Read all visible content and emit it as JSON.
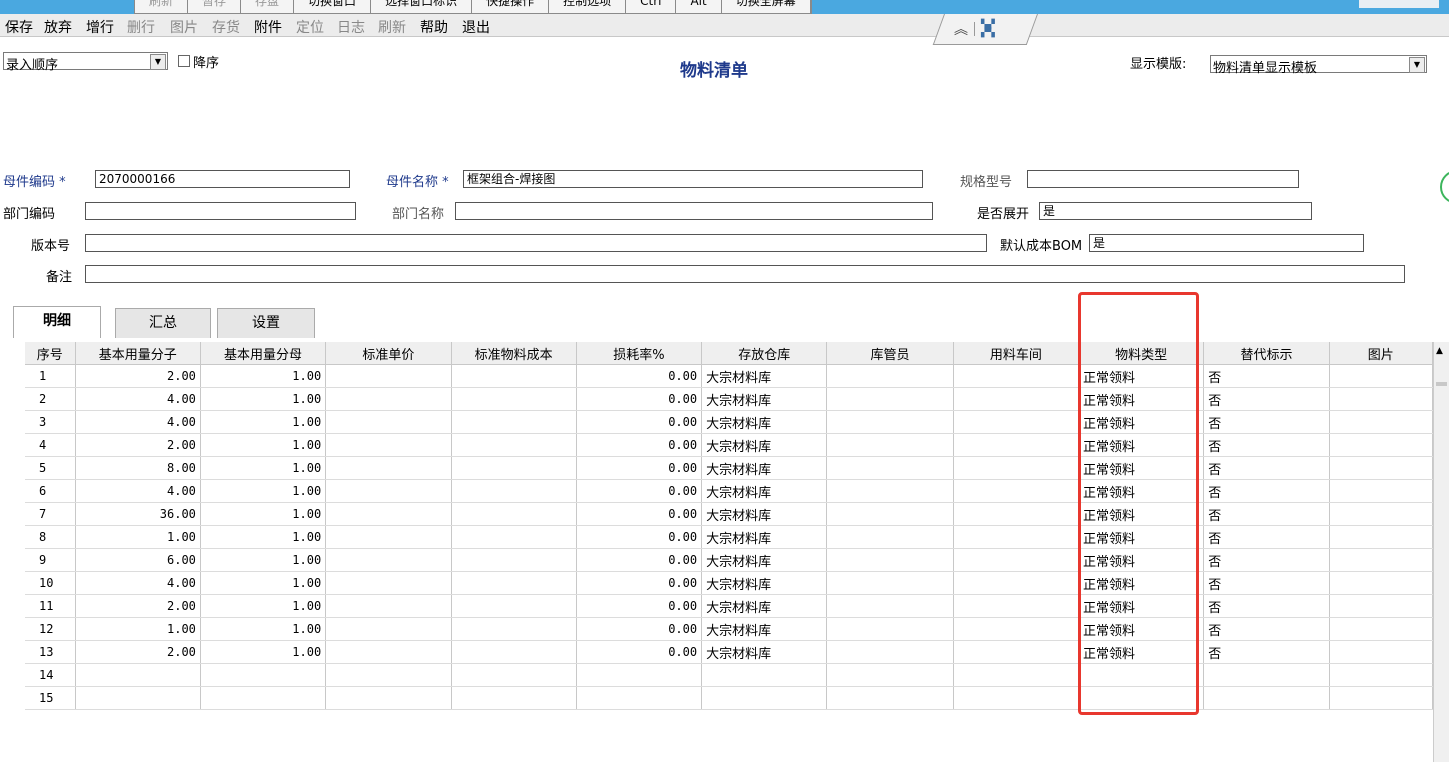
{
  "floating_toolbar": {
    "items": [
      "刷新",
      "暂存",
      "存盘",
      "切换窗口",
      "选择窗口标识",
      "快捷操作",
      "控制选项",
      "Ctrl",
      "Alt",
      "切换全屏幕"
    ]
  },
  "menu": {
    "items": [
      "保存",
      "放弃",
      "增行",
      "删行",
      "图片",
      "存货",
      "附件",
      "定位",
      "日志",
      "刷新",
      "帮助",
      "退出"
    ]
  },
  "header": {
    "sort_value": "录入顺序",
    "descending_label": "降序",
    "title": "物料清单",
    "template_label": "显示模版:",
    "template_value": "物料清单显示模板"
  },
  "form": {
    "parent_code_label": "母件编码",
    "parent_code_value": "2070000166",
    "parent_name_label": "母件名称",
    "parent_name_value": "框架组合-焊接图",
    "spec_label": "规格型号",
    "spec_value": "",
    "dept_code_label": "部门编码",
    "dept_code_value": "",
    "dept_name_label": "部门名称",
    "dept_name_value": "",
    "expand_label": "是否展开",
    "expand_value": "是",
    "version_label": "版本号",
    "version_value": "",
    "default_cost_label": "默认成本BOM",
    "default_cost_value": "是",
    "remark_label": "备注",
    "remark_value": ""
  },
  "tabs": [
    "明细",
    "汇总",
    "设置"
  ],
  "grid": {
    "columns": [
      "序号",
      "基本用量分子",
      "基本用量分母",
      "标准单价",
      "标准物料成本",
      "损耗率%",
      "存放仓库",
      "库管员",
      "用料车间",
      "物料类型",
      "替代标示",
      "图片"
    ],
    "rows": [
      {
        "no": "1",
        "num": "2.00",
        "den": "1.00",
        "loss": "0.00",
        "wh": "大宗材料库",
        "type": "正常领料",
        "alt": "否"
      },
      {
        "no": "2",
        "num": "4.00",
        "den": "1.00",
        "loss": "0.00",
        "wh": "大宗材料库",
        "type": "正常领料",
        "alt": "否"
      },
      {
        "no": "3",
        "num": "4.00",
        "den": "1.00",
        "loss": "0.00",
        "wh": "大宗材料库",
        "type": "正常领料",
        "alt": "否"
      },
      {
        "no": "4",
        "num": "2.00",
        "den": "1.00",
        "loss": "0.00",
        "wh": "大宗材料库",
        "type": "正常领料",
        "alt": "否"
      },
      {
        "no": "5",
        "num": "8.00",
        "den": "1.00",
        "loss": "0.00",
        "wh": "大宗材料库",
        "type": "正常领料",
        "alt": "否"
      },
      {
        "no": "6",
        "num": "4.00",
        "den": "1.00",
        "loss": "0.00",
        "wh": "大宗材料库",
        "type": "正常领料",
        "alt": "否"
      },
      {
        "no": "7",
        "num": "36.00",
        "den": "1.00",
        "loss": "0.00",
        "wh": "大宗材料库",
        "type": "正常领料",
        "alt": "否"
      },
      {
        "no": "8",
        "num": "1.00",
        "den": "1.00",
        "loss": "0.00",
        "wh": "大宗材料库",
        "type": "正常领料",
        "alt": "否"
      },
      {
        "no": "9",
        "num": "6.00",
        "den": "1.00",
        "loss": "0.00",
        "wh": "大宗材料库",
        "type": "正常领料",
        "alt": "否"
      },
      {
        "no": "10",
        "num": "4.00",
        "den": "1.00",
        "loss": "0.00",
        "wh": "大宗材料库",
        "type": "正常领料",
        "alt": "否"
      },
      {
        "no": "11",
        "num": "2.00",
        "den": "1.00",
        "loss": "0.00",
        "wh": "大宗材料库",
        "type": "正常领料",
        "alt": "否"
      },
      {
        "no": "12",
        "num": "1.00",
        "den": "1.00",
        "loss": "0.00",
        "wh": "大宗材料库",
        "type": "正常领料",
        "alt": "否"
      },
      {
        "no": "13",
        "num": "2.00",
        "den": "1.00",
        "loss": "0.00",
        "wh": "大宗材料库",
        "type": "正常领料",
        "alt": "否"
      },
      {
        "no": "14",
        "num": "",
        "den": "",
        "loss": "",
        "wh": "",
        "type": "",
        "alt": ""
      },
      {
        "no": "15",
        "num": "",
        "den": "",
        "loss": "",
        "wh": "",
        "type": "",
        "alt": ""
      }
    ]
  },
  "colors": {
    "title": "#1f3a8c",
    "highlight": "#e8372e",
    "topbar": "#4aa8e0"
  }
}
